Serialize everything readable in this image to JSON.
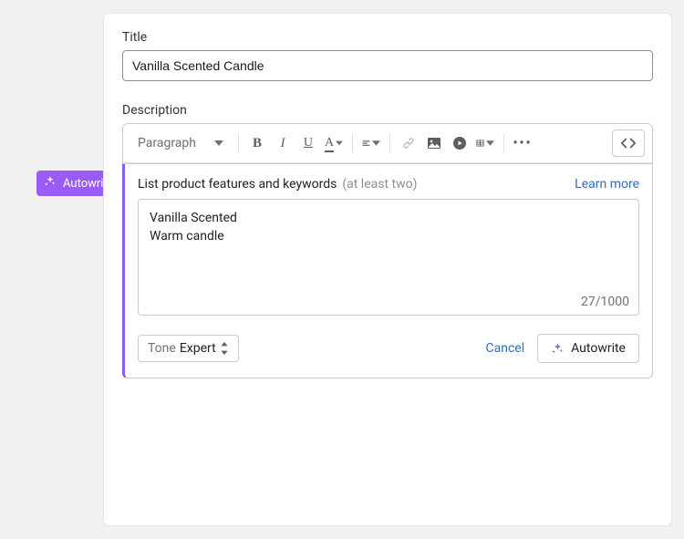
{
  "accent": "#8a5cf6",
  "title": {
    "label": "Title",
    "value": "Vanilla Scented Candle"
  },
  "description": {
    "label": "Description",
    "toolbar": {
      "paragraph": "Paragraph",
      "more": "•••"
    }
  },
  "autowrite_tag": "Autowrite",
  "autowrite_panel": {
    "instruction": "List product features and keywords",
    "hint": "(at least two)",
    "learn_more": "Learn more",
    "keywords_text": "Vanilla Scented\nWarm candle",
    "counter": "27/1000",
    "tone_label": "Tone",
    "tone_value": "Expert",
    "cancel": "Cancel",
    "go": "Autowrite"
  }
}
